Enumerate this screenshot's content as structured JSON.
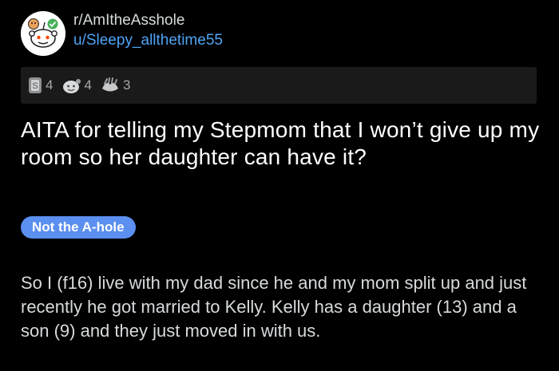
{
  "post": {
    "subreddit": "r/AmItheAsshole",
    "author": "u/Sleepy_allthetime55",
    "awards": [
      {
        "icon": "silver-award-icon",
        "count": "4"
      },
      {
        "icon": "wholesome-award-icon",
        "count": "4"
      },
      {
        "icon": "hug-award-icon",
        "count": "3"
      }
    ],
    "title": "AITA for telling my Stepmom that I won’t give up my room so her daughter can have it?",
    "flair": "Not the A-hole",
    "body": "So I (f16) live with my dad since he and my mom split up and just recently he got married to Kelly. Kelly has a daughter (13) and a son (9) and they just moved in with us."
  },
  "colors": {
    "background": "#000000",
    "username": "#4fa3f5",
    "flair_bg": "#5b8ff0",
    "award_bar": "#1a1a1b"
  }
}
